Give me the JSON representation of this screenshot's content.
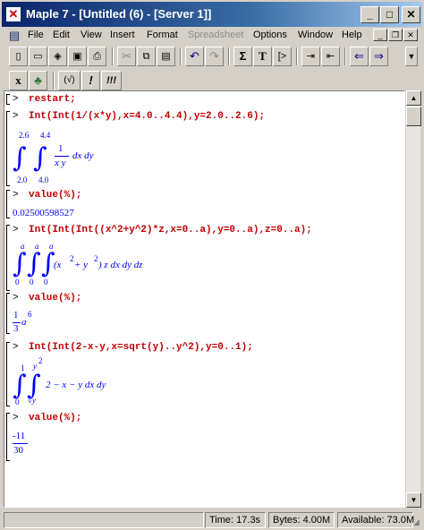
{
  "window": {
    "title": "Maple 7  - [Untitled (6) - [Server 1]]"
  },
  "menu": [
    {
      "label": "File",
      "enabled": true
    },
    {
      "label": "Edit",
      "enabled": true
    },
    {
      "label": "View",
      "enabled": true
    },
    {
      "label": "Insert",
      "enabled": true
    },
    {
      "label": "Format",
      "enabled": true
    },
    {
      "label": "Spreadsheet",
      "enabled": false
    },
    {
      "label": "Options",
      "enabled": true
    },
    {
      "label": "Window",
      "enabled": true
    },
    {
      "label": "Help",
      "enabled": true
    }
  ],
  "toolbar1": [
    "new-icon",
    "open-icon",
    "open-url-icon",
    "save-icon",
    "print-icon",
    "cut-icon",
    "copy-icon",
    "paste-icon",
    "undo-icon",
    "redo-icon",
    "sigma-icon",
    "text-icon",
    "insert-prompt-icon",
    "indent-icon",
    "outdent-icon",
    "back-icon",
    "forward-icon"
  ],
  "toolbar2": [
    {
      "label": "x",
      "name": "math-input-button"
    },
    {
      "label": "♣",
      "name": "maple-leaf-button"
    },
    {
      "label": "(√)",
      "name": "execute-button"
    },
    {
      "label": "!",
      "name": "execute-once-button"
    },
    {
      "label": "!!!",
      "name": "execute-all-button"
    }
  ],
  "worksheet": {
    "prompt": ">",
    "lines": {
      "c1": "restart;",
      "c2": "Int(Int(1/(x*y),x=4.0..4.4),y=2.0..2.6);",
      "c3": "value(%);",
      "c4": "Int(Int(Int((x^2+y^2)*z,x=0..a),y=0..a),z=0..a);",
      "c5": "value(%);",
      "c6": "Int(Int(2-x-y,x=sqrt(y)..y^2),y=0..1);",
      "c7": "value(%);"
    },
    "out1": {
      "outer_upper": "2.6",
      "outer_lower": "2.0",
      "inner_upper": "4.4",
      "inner_lower": "4.0",
      "num": "1",
      "den": "x y",
      "tail": "dx dy"
    },
    "out2": "0.02500598527",
    "out3": {
      "l1": "0",
      "l2": "0",
      "l3": "0",
      "u1": "a",
      "u2": "a",
      "u3": "a",
      "body": "(x",
      "sq1": "2",
      "plus": " + y",
      "sq2": "2",
      "tail": ") z dx dy dz"
    },
    "out4": {
      "num": "1",
      "den": "3",
      "var": "a",
      "exp": "6"
    },
    "out5": {
      "outer_lower": "0",
      "outer_upper": "1",
      "inner_lower": "√y",
      "inner_upper": "y",
      "inner_upper_exp": "2",
      "body": "2 − x − y dx dy"
    },
    "out6": {
      "num": "-11",
      "den": "30"
    }
  },
  "status": {
    "time": "Time: 17.3s",
    "bytes": "Bytes: 4.00M",
    "available": "Available: 73.0M"
  }
}
